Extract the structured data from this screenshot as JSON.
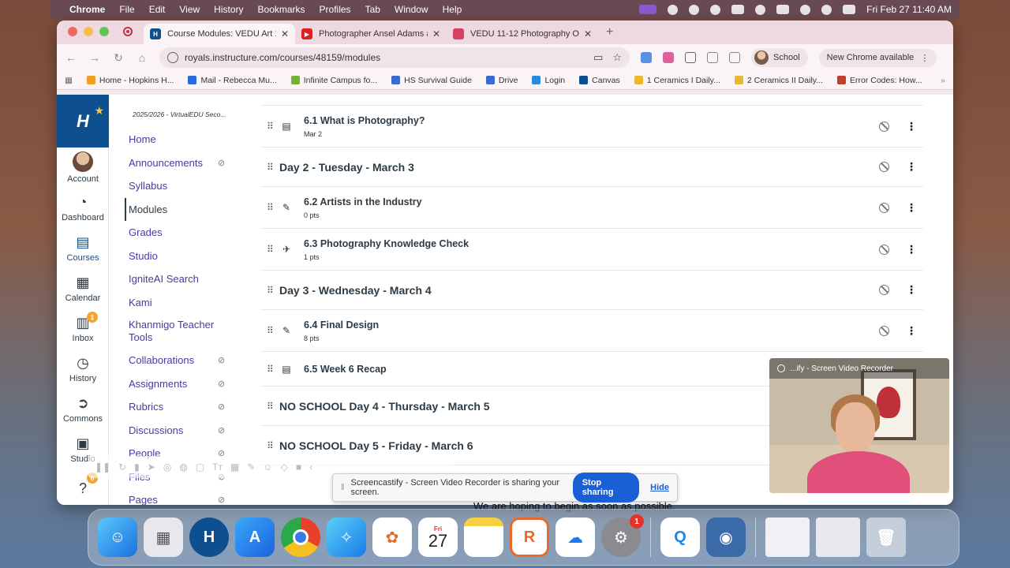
{
  "menubar": {
    "app": "Chrome",
    "items": [
      "File",
      "Edit",
      "View",
      "History",
      "Bookmarks",
      "Profiles",
      "Tab",
      "Window",
      "Help"
    ],
    "datetime": "Fri Feb 27  11:40 AM"
  },
  "tabs": [
    {
      "title": "Course Modules: VEDU Art 11",
      "active": true,
      "fav_color": "#0e4f8f"
    },
    {
      "title": "Photographer Ansel Adams a",
      "active": false,
      "fav_color": "#e02020"
    },
    {
      "title": "VEDU 11-12 Photography Ov",
      "active": false,
      "fav_color": "#d84060"
    }
  ],
  "toolbar": {
    "url": "royals.instructure.com/courses/48159/modules",
    "profile": "School",
    "new_chrome": "New Chrome available"
  },
  "bookmarks": [
    {
      "label": "Home - Hopkins H...",
      "color": "#f0a020"
    },
    {
      "label": "Mail - Rebecca Mu...",
      "color": "#2a6ad8"
    },
    {
      "label": "Infinite Campus fo...",
      "color": "#7ab030"
    },
    {
      "label": "HS Survival Guide",
      "color": "#3a6ad0"
    },
    {
      "label": "Drive",
      "color": "#3a6ad0"
    },
    {
      "label": "Login",
      "color": "#2a8ad8"
    },
    {
      "label": "Canvas",
      "color": "#0e4f8f"
    },
    {
      "label": "1 Ceramics I Daily...",
      "color": "#e8b830"
    },
    {
      "label": "2 Ceramics II Daily...",
      "color": "#e8b830"
    },
    {
      "label": "Error Codes: How...",
      "color": "#c04030"
    }
  ],
  "globalnav": {
    "items": [
      {
        "label": "Account",
        "icon": "avatar"
      },
      {
        "label": "Dashboard",
        "icon": "gauge-icon"
      },
      {
        "label": "Courses",
        "icon": "book-icon",
        "active": true
      },
      {
        "label": "Calendar",
        "icon": "calendar-icon"
      },
      {
        "label": "Inbox",
        "icon": "inbox-icon",
        "badge": "1"
      },
      {
        "label": "History",
        "icon": "clock-icon"
      },
      {
        "label": "Commons",
        "icon": "commons-icon"
      },
      {
        "label": "Studio",
        "icon": "studio-icon"
      },
      {
        "label": "Help",
        "icon": "help-icon",
        "badge": "6"
      }
    ]
  },
  "coursenav": {
    "term": "2025/2026 - VirtualEDU Seco...",
    "items": [
      {
        "label": "Home",
        "hidden": false
      },
      {
        "label": "Announcements",
        "hidden": true
      },
      {
        "label": "Syllabus",
        "hidden": false
      },
      {
        "label": "Modules",
        "hidden": false,
        "active": true
      },
      {
        "label": "Grades",
        "hidden": false
      },
      {
        "label": "Studio",
        "hidden": false
      },
      {
        "label": "IgniteAI Search",
        "hidden": false
      },
      {
        "label": "Kami",
        "hidden": false
      },
      {
        "label": "Khanmigo Teacher Tools",
        "hidden": false,
        "tall": true
      },
      {
        "label": "Collaborations",
        "hidden": true
      },
      {
        "label": "Assignments",
        "hidden": true
      },
      {
        "label": "Rubrics",
        "hidden": true
      },
      {
        "label": "Discussions",
        "hidden": true
      },
      {
        "label": "People",
        "hidden": true
      },
      {
        "label": "Files",
        "hidden": true
      },
      {
        "label": "Pages",
        "hidden": true
      }
    ]
  },
  "modules": [
    {
      "kind": "item",
      "icon": "page-icon",
      "title": "6.1 What is Photography?",
      "sub": "Mar 2"
    },
    {
      "kind": "header",
      "title": "Day 2 - Tuesday - March 3"
    },
    {
      "kind": "item",
      "icon": "assignment-icon",
      "title": "6.2 Artists in the Industry",
      "sub": "0 pts"
    },
    {
      "kind": "item",
      "icon": "quiz-rocket-icon",
      "title": "6.3 Photography Knowledge Check",
      "sub": "1 pts"
    },
    {
      "kind": "header",
      "title": "Day 3 - Wednesday - March 4"
    },
    {
      "kind": "item",
      "icon": "assignment-icon",
      "title": "6.4 Final Design",
      "sub": "8 pts"
    },
    {
      "kind": "item",
      "icon": "page-icon",
      "title": "6.5 Week 6 Recap",
      "sub": ""
    },
    {
      "kind": "header",
      "title": "NO SCHOOL Day 4 - Thursday - March 5"
    },
    {
      "kind": "header",
      "title": "NO SCHOOL Day 5 - Friday - March 6"
    }
  ],
  "sharebar": {
    "message": "Screencastify - Screen Video Recorder is sharing your screen.",
    "stop": "Stop sharing",
    "hide": "Hide"
  },
  "behind_text": "We are hoping to begin as soon as possible.",
  "webcam": {
    "title": "...ify - Screen Video Recorder"
  },
  "dock": {
    "calendar_day": "Fri",
    "calendar_date": "27",
    "settings_badge": "1"
  }
}
